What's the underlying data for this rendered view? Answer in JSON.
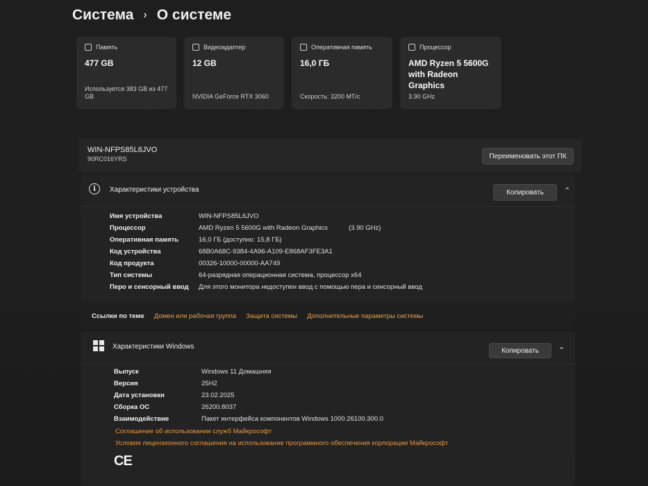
{
  "breadcrumb": {
    "parent": "Система",
    "separator": "›",
    "current": "О системе"
  },
  "cards": [
    {
      "title": "Память",
      "value": "477 GB",
      "sub": "Используется 383 GB из 477 GB"
    },
    {
      "title": "Видеоадаптер",
      "value": "12 GB",
      "sub": "NVIDIA GeForce RTX 3060"
    },
    {
      "title": "Оперативная память",
      "value": "16,0 ГБ",
      "sub": "Скорость: 3200 МТ/с"
    },
    {
      "title": "Процессор",
      "value": "AMD Ryzen 5 5600G with Radeon Graphics",
      "sub": "3.90 GHz"
    }
  ],
  "pc": {
    "name": "WIN-NFPS85L6JVO",
    "model": "90RC016YRS",
    "rename_label": "Переименовать этот ПК"
  },
  "device": {
    "title": "Характеристики устройства",
    "copy_label": "Копировать",
    "rows": [
      {
        "k": "Имя устройства",
        "v": "WIN-NFPS85L6JVO"
      },
      {
        "k": "Процессор",
        "v": "AMD Ryzen 5 5600G with Radeon Graphics",
        "extra": "(3.90 GHz)"
      },
      {
        "k": "Оперативная память",
        "v": "16,0 ГБ (доступно: 15,8 ГБ)"
      },
      {
        "k": "Код устройства",
        "v": "68B0A68C-9384-4A96-A109-E868AF3FE3A1"
      },
      {
        "k": "Код продукта",
        "v": "00326-10000-00000-AA749"
      },
      {
        "k": "Тип системы",
        "v": "64-разрядная операционная система, процессор x64"
      },
      {
        "k": "Перо и сенсорный ввод",
        "v": "Для этого монитора недоступен ввод с помощью пера и сенсорный ввод"
      }
    ]
  },
  "links": {
    "label": "Ссылки по теме",
    "items": [
      "Домен или рабочая группа",
      "Защита системы",
      "Дополнительные параметры системы"
    ]
  },
  "windows": {
    "title": "Характеристики Windows",
    "copy_label": "Копировать",
    "rows": [
      {
        "k": "Выпуск",
        "v": "Windows 11 Домашняя"
      },
      {
        "k": "Версия",
        "v": "25H2"
      },
      {
        "k": "Дата установки",
        "v": "23.02.2025"
      },
      {
        "k": "Сборка ОС",
        "v": "26200.8037"
      },
      {
        "k": "Взаимодействие",
        "v": "Пакет интерфейса компонентов Windows 1000.26100.300.0"
      }
    ],
    "license_links": [
      "Соглашение об использовании служб Майкрософт",
      "Условия лицензионного соглашения на использование программного обеспечения корпорации Майкрософт"
    ],
    "ce_mark": "CE"
  }
}
